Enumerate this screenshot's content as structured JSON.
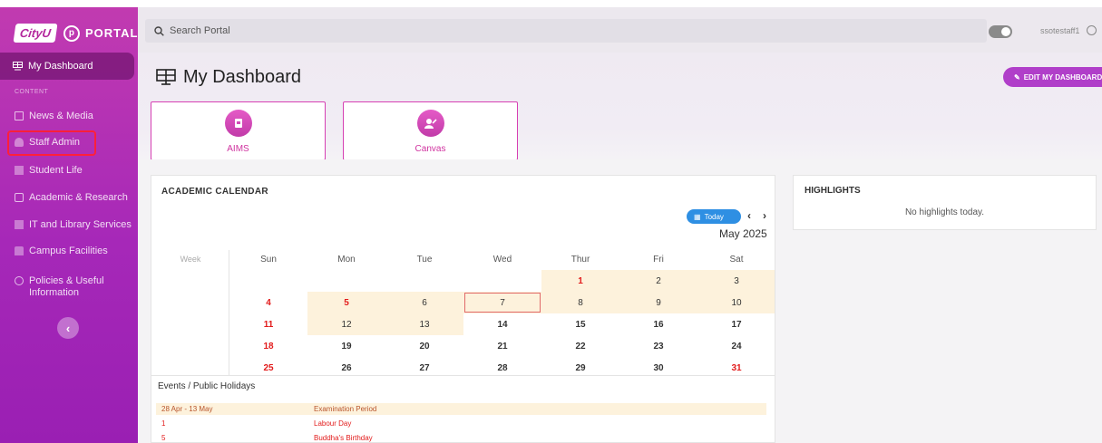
{
  "sidebar": {
    "logo_cityu": "CityU",
    "logo_p": "p",
    "logo_portal": "PORTAL",
    "active_item": "My Dashboard",
    "section_label": "CONTENT",
    "items": [
      {
        "label": "News & Media",
        "icon": "news-icon"
      },
      {
        "label": "Staff Admin",
        "icon": "staff-icon"
      },
      {
        "label": "Student Life",
        "icon": "student-icon"
      },
      {
        "label": "Academic & Research",
        "icon": "academic-icon"
      },
      {
        "label": "IT and Library Services",
        "icon": "library-icon"
      },
      {
        "label": "Campus Facilities",
        "icon": "campus-icon"
      },
      {
        "label": "Policies & Useful",
        "label2": "Information",
        "icon": "policies-icon"
      }
    ],
    "collapse_glyph": "‹"
  },
  "header": {
    "search_placeholder": "Search Portal",
    "username": "ssotestaff1"
  },
  "dashboard": {
    "title": "My Dashboard",
    "edit_button": "EDIT MY DASHBOARD",
    "apps": [
      {
        "label": "AIMS"
      },
      {
        "label": "Canvas"
      }
    ]
  },
  "calendar": {
    "title": "ACADEMIC CALENDAR",
    "today_button": "Today",
    "prev_glyph": "‹",
    "next_glyph": "›",
    "month": "May 2025",
    "week_header": "Week",
    "day_headers": [
      "Sun",
      "Mon",
      "Tue",
      "Wed",
      "Thur",
      "Fri",
      "Sat"
    ],
    "weeks": [
      [
        "",
        "",
        "",
        "",
        "1",
        "2",
        "3"
      ],
      [
        "4",
        "5",
        "6",
        "7",
        "8",
        "9",
        "10"
      ],
      [
        "11",
        "12",
        "13",
        "14",
        "15",
        "16",
        "17"
      ],
      [
        "18",
        "19",
        "20",
        "21",
        "22",
        "23",
        "24"
      ],
      [
        "25",
        "26",
        "27",
        "28",
        "29",
        "30",
        "31"
      ]
    ],
    "events_title": "Events / Public Holidays",
    "events": [
      {
        "date": "28 Apr - 13 May",
        "name": "Examination Period",
        "type": "exam"
      },
      {
        "date": "1",
        "name": "Labour Day",
        "type": "holiday"
      },
      {
        "date": "5",
        "name": "Buddha's Birthday",
        "type": "holiday"
      }
    ]
  },
  "highlights": {
    "title": "HIGHLIGHTS",
    "empty_text": "No highlights today."
  },
  "colors": {
    "brand": "#b3279c",
    "accent": "#b03ec9",
    "today_blue": "#2e8fe3",
    "holiday_red": "#e21b1b",
    "exam_shade": "#fdf2dc",
    "annotation_red": "#ff1f3a"
  }
}
